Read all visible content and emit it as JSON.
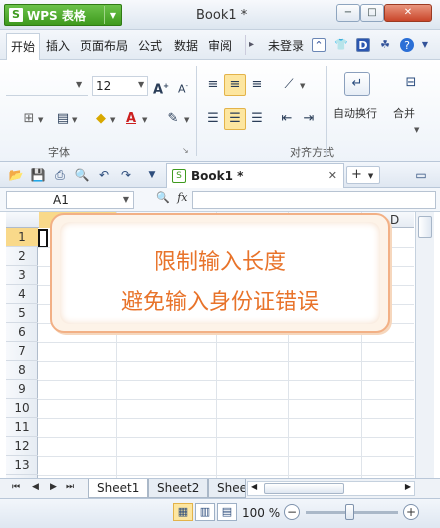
{
  "app": {
    "brand": "WPS 表格",
    "logo_letter": "S",
    "document_title": "Book1 *"
  },
  "window": {
    "minimize": "−",
    "maximize": "□",
    "close": "✕"
  },
  "menu": {
    "tabs": [
      "开始",
      "插入",
      "页面布局",
      "公式",
      "数据",
      "审阅"
    ],
    "active_tab": "开始",
    "login": "未登录"
  },
  "ribbon": {
    "font_name": "",
    "font_size": "12",
    "group_font": "字体",
    "group_align": "对齐方式",
    "wrap_text": "自动换行",
    "merge": "合并"
  },
  "doc_tab": {
    "label": "Book1 *",
    "new_tab": "+"
  },
  "formula_bar": {
    "cell_ref": "A1",
    "fx": "fx",
    "formula": ""
  },
  "grid": {
    "rows": [
      "1",
      "2",
      "3",
      "4",
      "5",
      "6",
      "7",
      "8",
      "9",
      "10",
      "11",
      "12",
      "13"
    ],
    "active_row": "1",
    "visible_col_label": "D"
  },
  "callout": {
    "line1": "限制输入长度",
    "line2": "避免输入身份证错误"
  },
  "sheets": {
    "tabs": [
      "Sheet1",
      "Sheet2",
      "Shee"
    ],
    "active": "Sheet1"
  },
  "status": {
    "zoom": "100 %",
    "zoom_level_percent": 100
  },
  "colors": {
    "brand_green": "#3e9a1e",
    "callout_text": "#e8732a",
    "active_highlight": "#f9d98a"
  }
}
